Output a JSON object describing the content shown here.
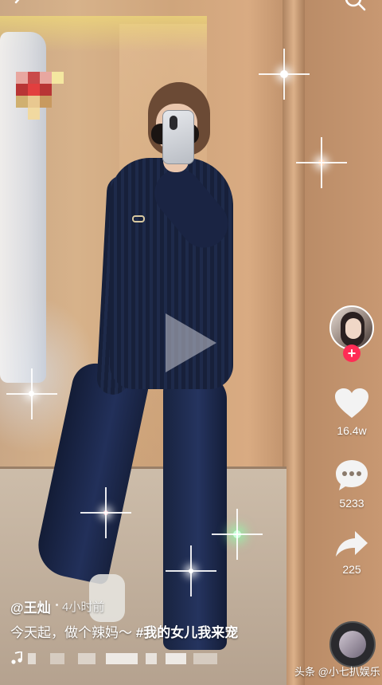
{
  "author": {
    "handle": "@王灿",
    "time": "4小时前"
  },
  "caption": {
    "text": "今天起，做个辣妈～ ",
    "hashtag": "#我的女儿我来宠"
  },
  "actions": {
    "like_count": "16.4w",
    "comment_count": "5233",
    "share_count": "225"
  },
  "follow": {
    "label": "+"
  },
  "watermark": {
    "text": "头条 @小七扒娱乐"
  },
  "colors": {
    "accent": "#ff2c55",
    "text": "#ffffff"
  },
  "icons": {
    "back": "back-arrow-icon",
    "search": "search-icon",
    "like": "heart-icon",
    "comment": "comment-icon",
    "share": "share-arrow-icon",
    "music": "music-note-icon",
    "play": "play-icon"
  }
}
